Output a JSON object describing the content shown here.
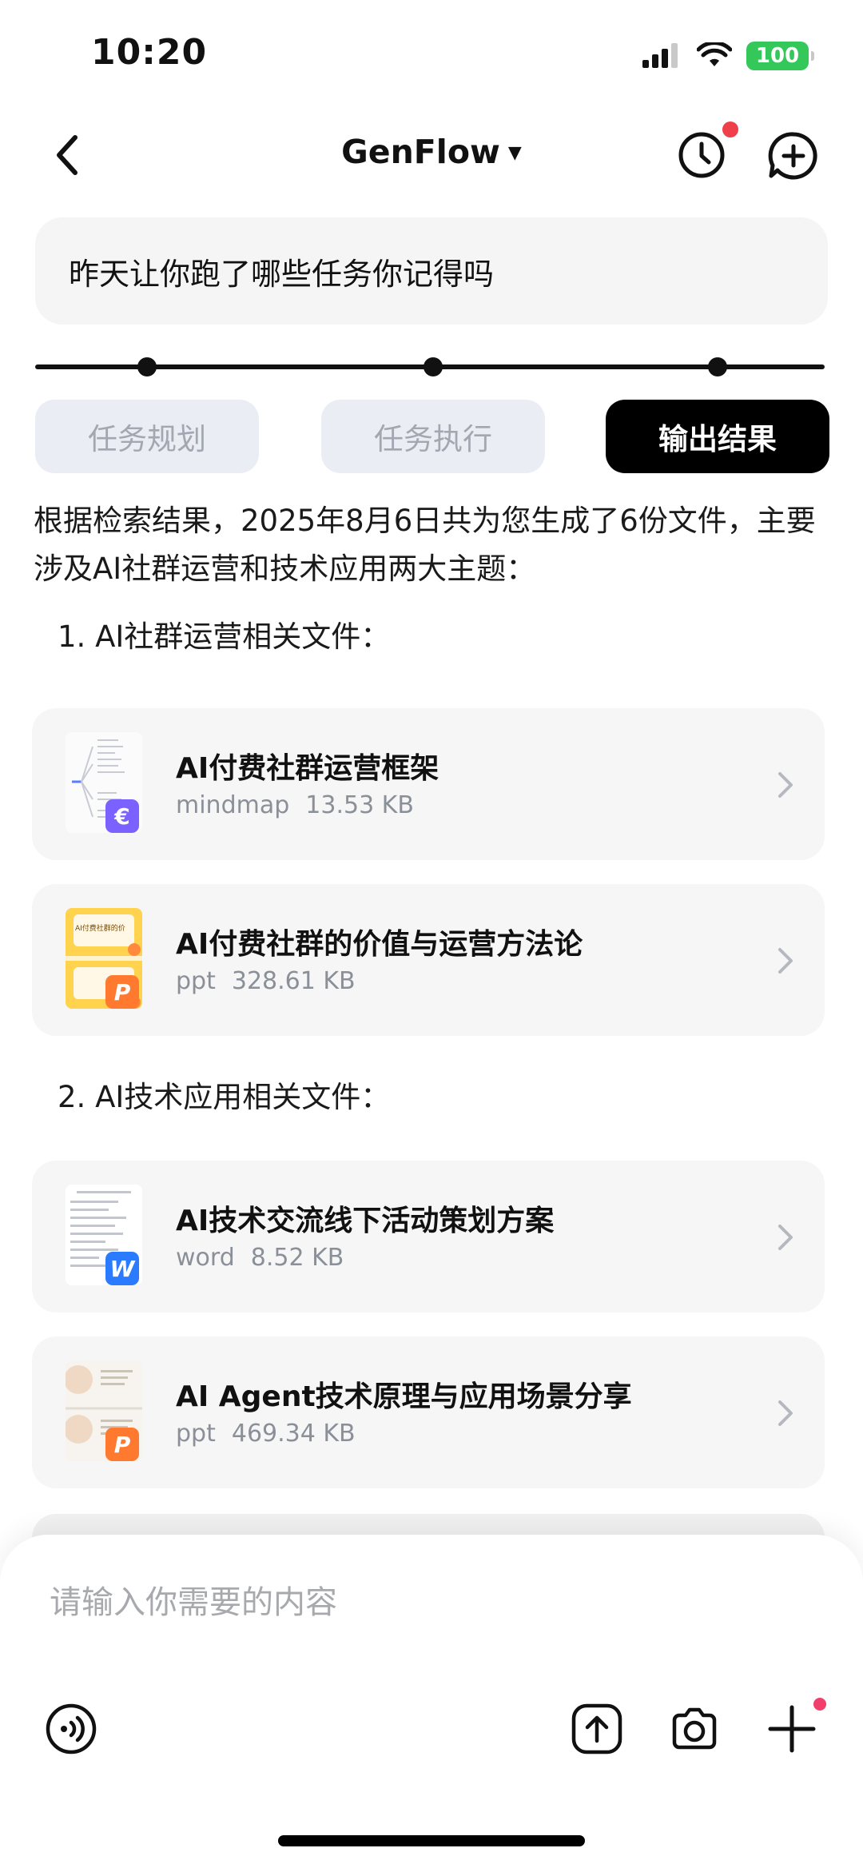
{
  "status_bar": {
    "time": "10:20",
    "battery": "100"
  },
  "header": {
    "title": "GenFlow"
  },
  "query": {
    "text": "昨天让你跑了哪些任务你记得吗"
  },
  "steps": [
    {
      "label": "任务规划",
      "active": false
    },
    {
      "label": "任务执行",
      "active": false
    },
    {
      "label": "输出结果",
      "active": true
    }
  ],
  "answer": {
    "intro": "根据检索结果，2025年8月6日共为您生成了6份文件，主要涉及AI社群运营和技术应用两大主题：",
    "section1": "1.  AI社群运营相关文件：",
    "section2": "2.  AI技术应用相关文件："
  },
  "files": [
    {
      "name": "AI付费社群运营框架",
      "type": "mindmap",
      "size": "13.53 KB",
      "badge": "€",
      "badge_color": "#7b61ff",
      "icon": "mindmap-icon"
    },
    {
      "name": "AI付费社群的价值与运营方法论",
      "type": "ppt",
      "size": "328.61 KB",
      "badge": "P",
      "badge_color": "#ff7a2f",
      "icon": "ppt-icon",
      "thumb_caption": "AI付费社群的价"
    },
    {
      "name": "AI技术交流线下活动策划方案",
      "type": "word",
      "size": "8.52 KB",
      "badge": "W",
      "badge_color": "#2b7bff",
      "icon": "word-icon"
    },
    {
      "name": "AI Agent技术原理与应用场景分享",
      "type": "ppt",
      "size": "469.34 KB",
      "badge": "P",
      "badge_color": "#ff7a2f",
      "icon": "ppt-icon"
    }
  ],
  "composer": {
    "placeholder": "请输入你需要的内容"
  },
  "colors": {
    "accent": "#000000",
    "notify_dot": "#ef3f4a",
    "battery": "#34c759"
  }
}
